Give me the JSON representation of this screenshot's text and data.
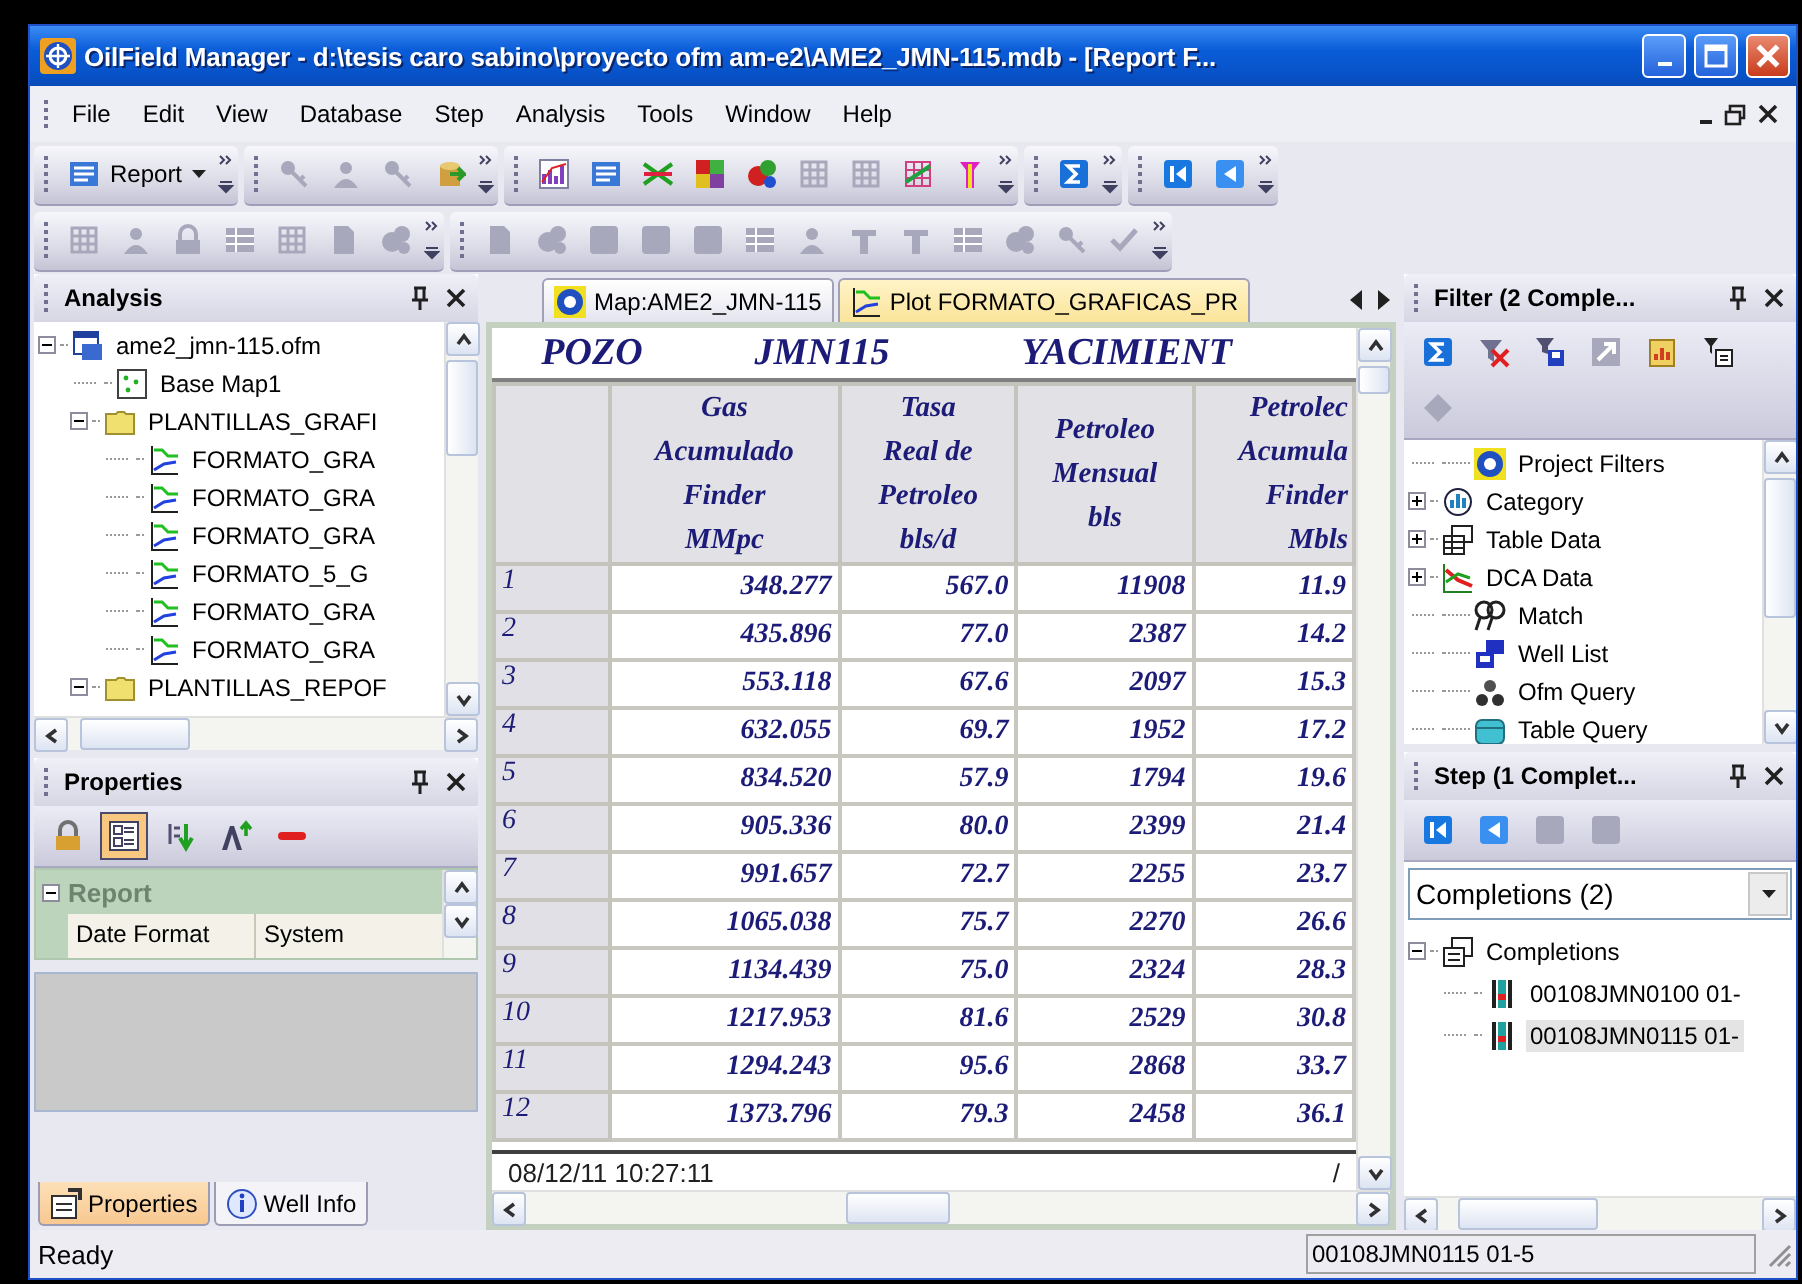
{
  "window": {
    "title": "OilField Manager - d:\\tesis caro sabino\\proyecto ofm am-e2\\AME2_JMN-115.mdb - [Report F..."
  },
  "menu": [
    "File",
    "Edit",
    "View",
    "Database",
    "Step",
    "Analysis",
    "Tools",
    "Window",
    "Help"
  ],
  "toolbars": [
    {
      "groups": [
        {
          "buttons": [
            {
              "kind": "dropdown",
              "label": "Report",
              "disabled": false
            }
          ]
        },
        {
          "buttons": [
            {
              "kind": "key",
              "disabled": true
            },
            {
              "kind": "person",
              "disabled": true
            },
            {
              "kind": "key",
              "disabled": true
            },
            {
              "kind": "database",
              "disabled": false
            }
          ]
        },
        {
          "buttons": [
            {
              "kind": "chart",
              "disabled": false
            },
            {
              "kind": "report",
              "disabled": false
            },
            {
              "kind": "crossplot",
              "disabled": false
            },
            {
              "kind": "mosaic",
              "disabled": false
            },
            {
              "kind": "bubble",
              "disabled": false
            },
            {
              "kind": "grid",
              "disabled": true
            },
            {
              "kind": "grid",
              "disabled": true
            },
            {
              "kind": "crossgrid",
              "disabled": false
            },
            {
              "kind": "wellbore",
              "disabled": false
            }
          ]
        },
        {
          "buttons": [
            {
              "kind": "sigma",
              "disabled": false
            }
          ]
        },
        {
          "buttons": [
            {
              "kind": "first",
              "disabled": false
            },
            {
              "kind": "prev",
              "disabled": false
            }
          ]
        }
      ]
    },
    {
      "groups": [
        {
          "buttons": [
            {
              "kind": "grid",
              "disabled": true
            },
            {
              "kind": "person",
              "disabled": true
            },
            {
              "kind": "lock",
              "disabled": true
            },
            {
              "kind": "table",
              "disabled": true
            },
            {
              "kind": "grid",
              "disabled": true
            },
            {
              "kind": "doc",
              "disabled": true
            },
            {
              "kind": "bubble",
              "disabled": true
            }
          ]
        },
        {
          "buttons": [
            {
              "kind": "doc",
              "disabled": true
            },
            {
              "kind": "bubble",
              "disabled": true
            },
            {
              "kind": "blank",
              "disabled": true
            },
            {
              "kind": "blank",
              "disabled": true
            },
            {
              "kind": "blank",
              "disabled": true
            },
            {
              "kind": "table",
              "disabled": true
            },
            {
              "kind": "person",
              "disabled": true
            },
            {
              "kind": "tee",
              "disabled": true
            },
            {
              "kind": "tee",
              "disabled": true
            },
            {
              "kind": "table",
              "disabled": true
            },
            {
              "kind": "bubble",
              "disabled": true
            },
            {
              "kind": "key",
              "disabled": true
            },
            {
              "kind": "check",
              "disabled": true
            }
          ]
        }
      ]
    }
  ],
  "analysis": {
    "title": "Analysis",
    "tree": [
      {
        "label": "ame2_jmn-115.ofm",
        "kind": "project",
        "expanded": true,
        "children": [
          {
            "label": "Base Map1",
            "kind": "map"
          },
          {
            "label": "PLANTILLAS_GRAFI",
            "kind": "folder",
            "expanded": true,
            "children": [
              {
                "label": "FORMATO_GRA",
                "kind": "plot"
              },
              {
                "label": "FORMATO_GRA",
                "kind": "plot"
              },
              {
                "label": "FORMATO_GRA",
                "kind": "plot"
              },
              {
                "label": "FORMATO_5_G",
                "kind": "plot"
              },
              {
                "label": "FORMATO_GRA",
                "kind": "plot"
              },
              {
                "label": "FORMATO_GRA",
                "kind": "plot"
              }
            ]
          },
          {
            "label": "PLANTILLAS_REPOF",
            "kind": "folder",
            "expanded": true
          }
        ]
      }
    ]
  },
  "properties": {
    "title": "Properties",
    "toolbar": [
      {
        "kind": "lock",
        "selected": false
      },
      {
        "kind": "categorized",
        "selected": true
      },
      {
        "kind": "sort",
        "selected": false
      },
      {
        "kind": "fontsize",
        "selected": false
      },
      {
        "kind": "minus",
        "selected": false
      }
    ],
    "category": {
      "label": "Report",
      "expanded": true,
      "disabled": true
    },
    "rows": [
      {
        "name": "Date Format",
        "value": "System"
      }
    ],
    "tabs": [
      {
        "label": "Properties",
        "kind": "properties",
        "selected": true
      },
      {
        "label": "Well Info",
        "kind": "info",
        "selected": false
      }
    ]
  },
  "documents": [
    {
      "label": "Map:AME2_JMN-115",
      "kind": "map",
      "selected": false
    },
    {
      "label": "Plot FORMATO_GRAFICAS_PR",
      "kind": "plot",
      "selected": true
    }
  ],
  "report": {
    "heading": [
      "POZO",
      "JMN115",
      "YACIMIENT"
    ],
    "columns": [
      "Gas\nAcumulado\nFinder\nMMpc",
      "Tasa\nReal de\nPetroleo\nbls/d",
      "Petroleo\nMensual\nbls",
      "Petrolec\nAcumula\nFinder\nMbls"
    ],
    "rows": [
      {
        "number": "1",
        "values": [
          "348.277",
          "567.0",
          "11908",
          "11.9"
        ]
      },
      {
        "number": "2",
        "values": [
          "435.896",
          "77.0",
          "2387",
          "14.2"
        ]
      },
      {
        "number": "3",
        "values": [
          "553.118",
          "67.6",
          "2097",
          "15.3"
        ]
      },
      {
        "number": "4",
        "values": [
          "632.055",
          "69.7",
          "1952",
          "17.2"
        ]
      },
      {
        "number": "5",
        "values": [
          "834.520",
          "57.9",
          "1794",
          "19.6"
        ]
      },
      {
        "number": "6",
        "values": [
          "905.336",
          "80.0",
          "2399",
          "21.4"
        ]
      },
      {
        "number": "7",
        "values": [
          "991.657",
          "72.7",
          "2255",
          "23.7"
        ]
      },
      {
        "number": "8",
        "values": [
          "1065.038",
          "75.7",
          "2270",
          "26.6"
        ]
      },
      {
        "number": "9",
        "values": [
          "1134.439",
          "75.0",
          "2324",
          "28.3"
        ]
      },
      {
        "number": "10",
        "values": [
          "1217.953",
          "81.6",
          "2529",
          "30.8"
        ]
      },
      {
        "number": "11",
        "values": [
          "1294.243",
          "95.6",
          "2868",
          "33.7"
        ]
      },
      {
        "number": "12",
        "values": [
          "1373.796",
          "79.3",
          "2458",
          "36.1"
        ]
      }
    ],
    "footer": {
      "timestamp": "08/12/11 10:27:11",
      "page": "/"
    }
  },
  "filter": {
    "title": "Filter (2 Comple...",
    "toolbar": [
      {
        "kind": "sigma",
        "disabled": false
      },
      {
        "kind": "funnelx",
        "disabled": false
      },
      {
        "kind": "savefilter",
        "disabled": false
      },
      {
        "kind": "arrowbox",
        "disabled": true
      },
      {
        "kind": "notepad",
        "disabled": false
      },
      {
        "kind": "filterlist",
        "disabled": false
      },
      {
        "kind": "diamond",
        "disabled": true
      }
    ],
    "tree": [
      {
        "label": "Project Filters",
        "kind": "projectfilters"
      },
      {
        "label": "Category",
        "kind": "category",
        "expanded": false
      },
      {
        "label": "Table Data",
        "kind": "table",
        "expanded": false
      },
      {
        "label": "DCA Data",
        "kind": "dca",
        "expanded": false
      },
      {
        "label": "Match",
        "kind": "match"
      },
      {
        "label": "Well List",
        "kind": "welllist"
      },
      {
        "label": "Ofm Query",
        "kind": "query"
      },
      {
        "label": "Table Query",
        "kind": "tablequery"
      }
    ]
  },
  "step": {
    "title": "Step (1 Complet...",
    "toolbar": [
      {
        "kind": "first",
        "disabled": false
      },
      {
        "kind": "prev",
        "disabled": false
      },
      {
        "kind": "blank",
        "disabled": true
      },
      {
        "kind": "blank",
        "disabled": true
      }
    ],
    "combo": {
      "value": "Completions (2)"
    },
    "tree": [
      {
        "label": "Completions",
        "kind": "completions",
        "expanded": true,
        "selected": false,
        "children": [
          {
            "label": "00108JMN0100  01-",
            "kind": "well",
            "selected": false
          },
          {
            "label": "00108JMN0115  01-",
            "kind": "well",
            "selected": true
          }
        ]
      }
    ]
  },
  "status_bar": {
    "message": "Ready",
    "completion": "00108JMN0115  01-5"
  }
}
